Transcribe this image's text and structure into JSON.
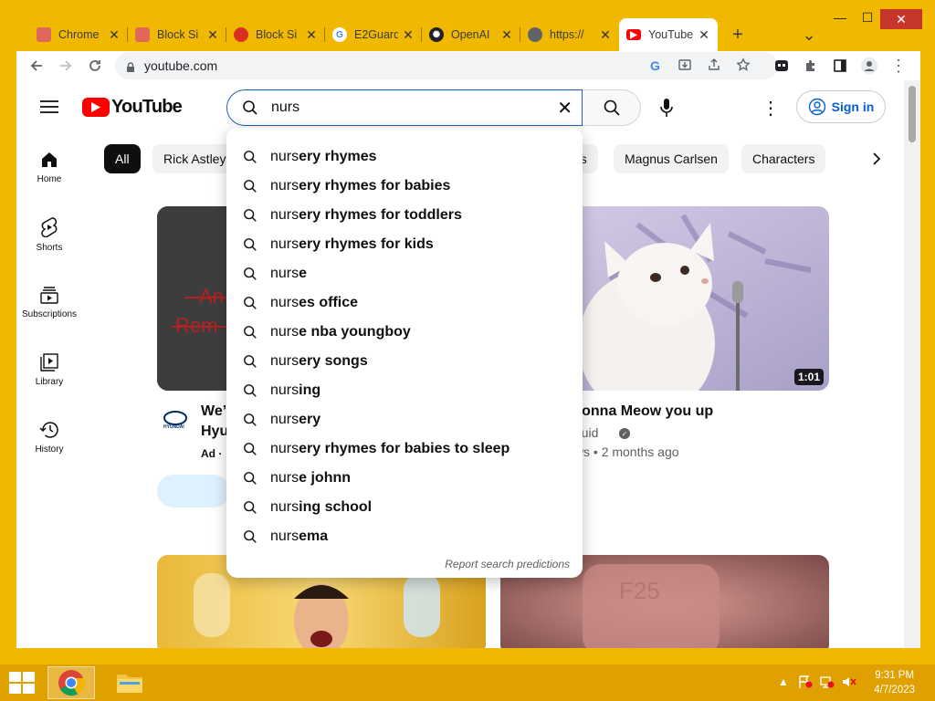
{
  "browser": {
    "tabs": [
      {
        "title": "Chrome",
        "fav_color": "#e0685a"
      },
      {
        "title": "Block Si",
        "fav_color": "#e0685a"
      },
      {
        "title": "Block Si",
        "fav_color": "#d93025"
      },
      {
        "title": "E2Guard",
        "fav_color": "#4285f4"
      },
      {
        "title": "OpenAI",
        "fav_color": "#202124"
      },
      {
        "title": "https://",
        "fav_color": "#5f6368"
      },
      {
        "title": "YouTube",
        "fav_color": "#ff0000"
      }
    ],
    "new_tab": "+",
    "tab_list": "⌄",
    "url": "youtube.com",
    "window": {
      "minimize": "—",
      "maximize": "☐",
      "close": "✕"
    }
  },
  "youtube": {
    "logo_text": "YouTube",
    "search": {
      "value": "nurs",
      "clear": "✕"
    },
    "signin_label": "Sign in",
    "nav": [
      {
        "label": "Home",
        "icon": "home-icon"
      },
      {
        "label": "Shorts",
        "icon": "shorts-icon"
      },
      {
        "label": "Subscriptions",
        "icon": "subscriptions-icon"
      },
      {
        "label": "Library",
        "icon": "library-icon"
      },
      {
        "label": "History",
        "icon": "history-icon"
      }
    ],
    "chips": [
      "All",
      "Rick Astley",
      "es",
      "Magnus Carlsen",
      "Characters"
    ],
    "suggestions": [
      {
        "typed": "nurs",
        "rest": "ery rhymes"
      },
      {
        "typed": "nurs",
        "rest": "ery rhymes for babies"
      },
      {
        "typed": "nurs",
        "rest": "ery rhymes for toddlers"
      },
      {
        "typed": "nurs",
        "rest": "ery rhymes for kids"
      },
      {
        "typed": "nurs",
        "rest": "e"
      },
      {
        "typed": "nurs",
        "rest": "es office"
      },
      {
        "typed": "nurs",
        "rest": "e nba youngboy"
      },
      {
        "typed": "nurs",
        "rest": "ery songs"
      },
      {
        "typed": "nurs",
        "rest": "ing"
      },
      {
        "typed": "nurs",
        "rest": "ery"
      },
      {
        "typed": "nurs",
        "rest": "ery rhymes for babies to sleep"
      },
      {
        "typed": "nurs",
        "rest": "e johnn"
      },
      {
        "typed": "nurs",
        "rest": "ing school"
      },
      {
        "typed": "nurs",
        "rest": "ema"
      }
    ],
    "report_label": "Report search predictions",
    "videos": [
      {
        "title_line1": "We’",
        "title_line2": "Hyu",
        "meta": "Ad ·",
        "channel_logo": "HYUNDAI",
        "thumb_text": "An Rem"
      },
      {
        "title": "y gonna Meow you up",
        "channel": "Liquid",
        "meta": "iews • 2 months ago",
        "duration": "1:01"
      }
    ]
  },
  "taskbar": {
    "time": "9:31 PM",
    "date": "4/7/2023"
  }
}
